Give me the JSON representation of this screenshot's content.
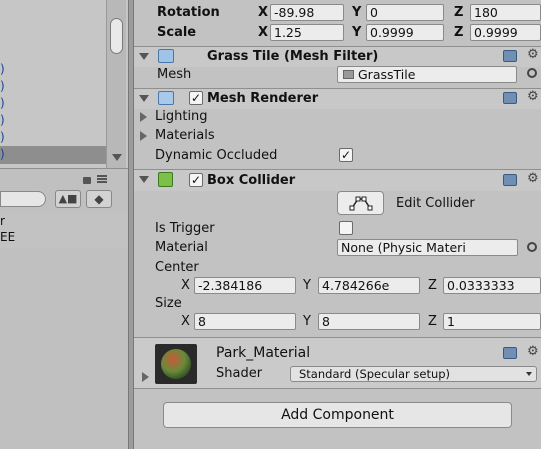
{
  "left_panel": {
    "list_items": [
      ")",
      ")",
      ")",
      ")",
      ")",
      ")"
    ],
    "project_items": [
      "r",
      "EE"
    ]
  },
  "transform": {
    "rotation_label": "Rotation",
    "rotation": {
      "x": "-89.98",
      "y": "0",
      "z": "180"
    },
    "scale_label": "Scale",
    "scale": {
      "x": "1.25",
      "y": "0.9999",
      "z": "0.9999"
    }
  },
  "mesh_filter": {
    "title": "Grass Tile (Mesh Filter)",
    "mesh_label": "Mesh",
    "mesh_value": "GrassTile"
  },
  "mesh_renderer": {
    "title": "Mesh Renderer",
    "lighting_label": "Lighting",
    "materials_label": "Materials",
    "dynamic_occluded_label": "Dynamic Occluded"
  },
  "box_collider": {
    "title": "Box Collider",
    "edit_collider_label": "Edit Collider",
    "is_trigger_label": "Is Trigger",
    "material_label": "Material",
    "material_value": "None (Physic Materi",
    "center_label": "Center",
    "center": {
      "x": "-2.384186",
      "y": "4.784266e",
      "z": "0.0333333"
    },
    "size_label": "Size",
    "size": {
      "x": "8",
      "y": "8",
      "z": "1"
    }
  },
  "material": {
    "name": "Park_Material",
    "shader_label": "Shader",
    "shader_value": "Standard (Specular setup)"
  },
  "axis_labels": {
    "x": "X",
    "y": "Y",
    "z": "Z"
  },
  "add_component_label": "Add Component",
  "colors": {
    "panel_bg": "#c2c2c2",
    "selection": "#8e8e8e",
    "accent_blue": "#6f8fb5"
  }
}
